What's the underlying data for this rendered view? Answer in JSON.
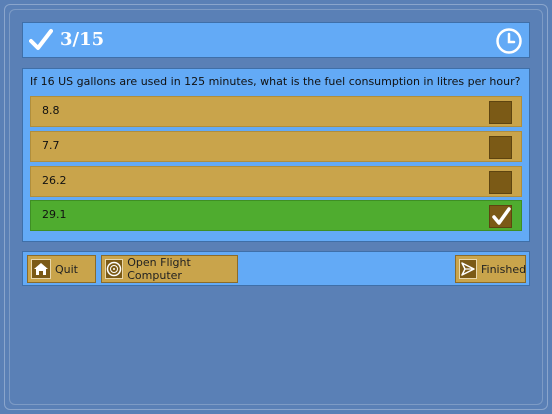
{
  "header": {
    "progress": "3/15",
    "check_icon": "check-icon",
    "timer_icon": "clock-icon"
  },
  "question": {
    "text": "If 16 US gallons are used in 125 minutes, what is the fuel consumption in litres per hour?",
    "answers": [
      {
        "label": "8.8",
        "selected": false
      },
      {
        "label": "7.7",
        "selected": false
      },
      {
        "label": "26.2",
        "selected": false
      },
      {
        "label": "29.1",
        "selected": true
      }
    ]
  },
  "toolbar": {
    "quit_label": "Quit",
    "flight_computer_label": "Open Flight Computer",
    "finished_label": "Finished"
  },
  "colors": {
    "background": "#5a80b6",
    "panel": "#63aaf6",
    "answer": "#c9a44b",
    "answer_selected": "#4fac2f",
    "checkbox": "#7b5a16"
  }
}
